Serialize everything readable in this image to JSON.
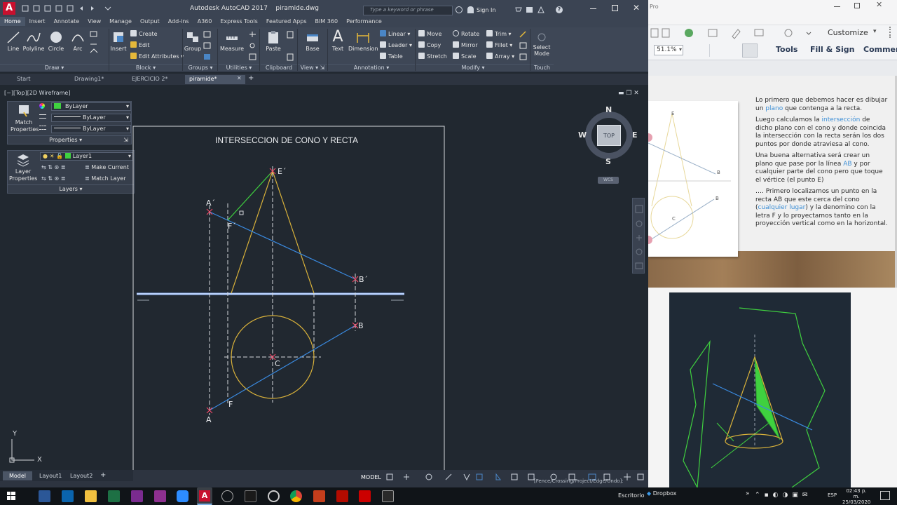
{
  "acad": {
    "title_app": "Autodesk AutoCAD 2017",
    "title_file": "piramide.dwg",
    "search_placeholder": "Type a keyword or phrase",
    "sign_in": "Sign In",
    "tabs": [
      "Home",
      "Insert",
      "Annotate",
      "View",
      "Manage",
      "Output",
      "Add-ins",
      "A360",
      "Express Tools",
      "Featured Apps",
      "BIM 360",
      "Performance"
    ],
    "ribbon": {
      "draw": {
        "line": "Line",
        "polyline": "Polyline",
        "circle": "Circle",
        "arc": "Arc",
        "label": "Draw"
      },
      "block": {
        "insert": "Insert",
        "create": "Create",
        "edit": "Edit",
        "edit_attr": "Edit Attributes",
        "label": "Block"
      },
      "groups": {
        "group": "Group",
        "label": "Groups"
      },
      "utilities": {
        "measure": "Measure",
        "label": "Utilities"
      },
      "clipboard": {
        "paste": "Paste",
        "label": "Clipboard"
      },
      "view": {
        "base": "Base",
        "label": "View"
      },
      "annotation": {
        "text": "Text",
        "dimension": "Dimension",
        "linear": "Linear",
        "leader": "Leader",
        "table": "Table",
        "label": "Annotation"
      },
      "modify": {
        "move": "Move",
        "rotate": "Rotate",
        "trim": "Trim",
        "copy": "Copy",
        "mirror": "Mirror",
        "fillet": "Fillet",
        "stretch": "Stretch",
        "scale": "Scale",
        "array": "Array",
        "label": "Modify"
      },
      "touch": {
        "select_mode": "Select Mode",
        "label": "Touch"
      }
    },
    "file_tabs": [
      "Start",
      "Drawing1*",
      "EJERCICIO 2*",
      "piramide*"
    ],
    "viewport_label": "[−][Top][2D Wireframe]",
    "properties_panel": {
      "match": "Match Properties",
      "color": "ByLayer",
      "linetype": "ByLayer",
      "lineweight": "ByLayer",
      "label": "Properties"
    },
    "layers_panel": {
      "layer_props": "Layer Properties",
      "layer": "Layer1",
      "make_current": "Make Current",
      "match_layer": "Match Layer",
      "label": "Layers"
    },
    "drawing": {
      "title": "INTERSECCION DE CONO Y RECTA",
      "labels": {
        "e1": "E´",
        "a1": "A´",
        "f1": "F´",
        "b1": "B´",
        "b": "B",
        "c": "C",
        "f": "F",
        "a": "A"
      }
    },
    "viewcube": {
      "n": "N",
      "s": "S",
      "e": "E",
      "w": "W",
      "top": "TOP",
      "wcs": "WCS"
    },
    "ucs": {
      "x": "X",
      "y": "Y"
    },
    "layout_tabs": [
      "Model",
      "Layout1",
      "Layout2"
    ],
    "status_model": "MODEL",
    "command_hint": "[Fence/Crossing/Project/Edge/Undo]:"
  },
  "pdf": {
    "pro_label": "Pro",
    "zoom": "51.1%",
    "customize": "Customize",
    "tools": "Tools",
    "fill_sign": "Fill & Sign",
    "comment": "Commen",
    "fig_labels": {
      "e": "E",
      "b1": "B",
      "b2": "B",
      "c": "C"
    },
    "paragraphs": [
      {
        "pre": "Lo primero que debemos hacer es dibujar un ",
        "hl": "plano",
        "post": " que contenga a la recta."
      },
      {
        "pre": "Luego calculamos la ",
        "hl": "intersección",
        "post": " de dicho plano con el cono y donde coincida la intersección con la recta serán los dos puntos por donde atraviesa al cono."
      },
      {
        "pre": "Una buena alternativa será crear un plano que pase por la línea ",
        "hl": "AB",
        "post": " y por cualquier parte del cono pero que toque el vértice (el punto E)"
      },
      {
        "pre": "…. Primero localizamos un punto en la recta AB que este cerca del cono (",
        "hl": "cualquier lugar",
        "post": ") y la denomino con la letra F y lo proyectamos tanto en la proyección vertical como en la horizontal."
      }
    ]
  },
  "taskbar": {
    "desktop": "Escritorio",
    "dropbox": "Dropbox",
    "lang": "ESP",
    "time": "02:43 p. m.",
    "date": "25/03/2020"
  }
}
